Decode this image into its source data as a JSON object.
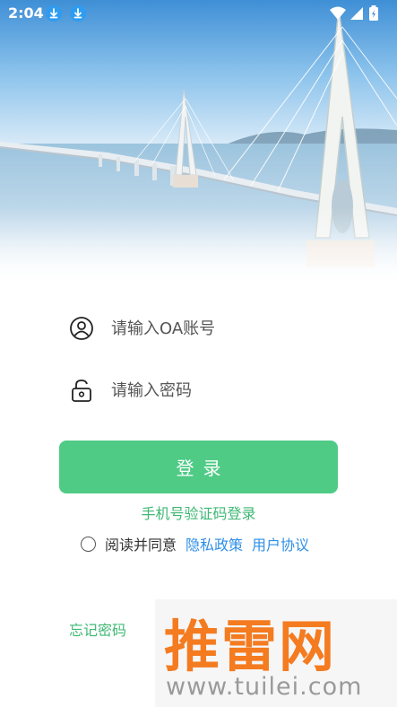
{
  "status_bar": {
    "time": "2:04",
    "icons": [
      "download-icon",
      "download-icon",
      "wifi-icon",
      "cell-signal-icon",
      "battery-charging-icon"
    ]
  },
  "login_form": {
    "account_placeholder": "请输入OA账号",
    "password_placeholder": "请输入密码",
    "account_icon": "user-icon",
    "password_icon": "lock-icon",
    "login_label": "登录",
    "sms_login_label": "手机号验证码登录",
    "agree_text": "阅读并同意",
    "privacy_policy": "隐私政策",
    "user_agreement": "用户协议",
    "forgot_password": "忘记密码"
  },
  "watermark": {
    "brand": "推雷网",
    "url": "www.tuilei.com"
  },
  "colors": {
    "accent_green": "#4fcb86",
    "link_green": "#3fb874",
    "link_blue": "#2f8fe6",
    "watermark_orange": "#f47b20"
  }
}
